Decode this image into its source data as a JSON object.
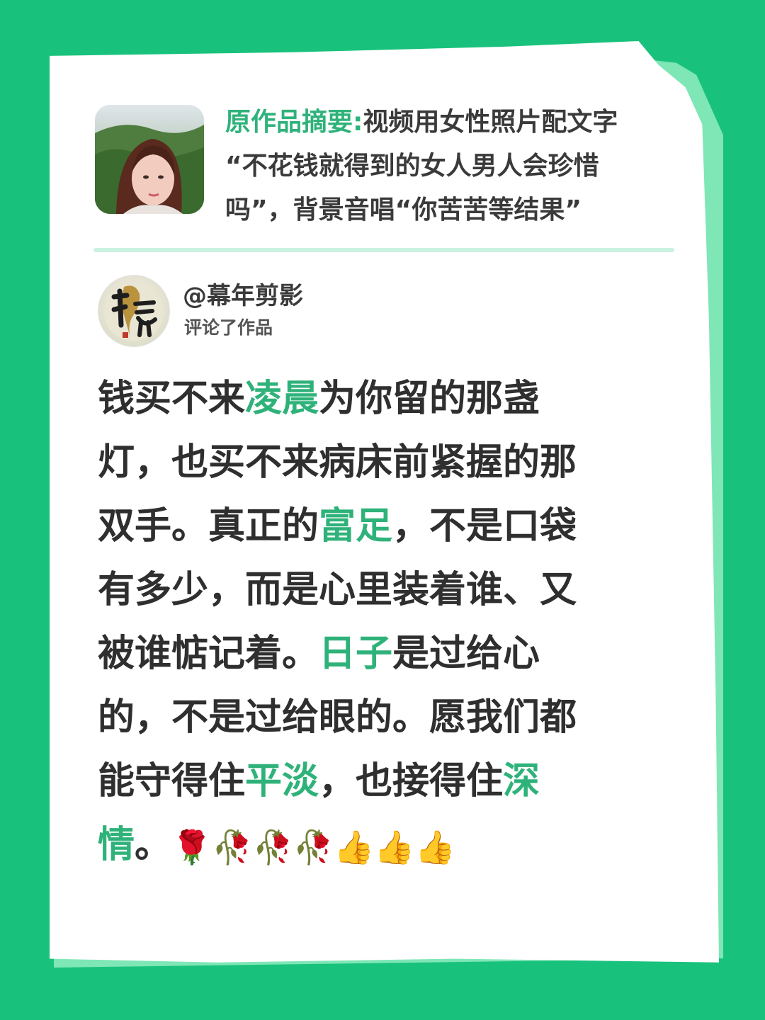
{
  "colors": {
    "background": "#19c27c",
    "accent": "#2fb27a",
    "text": "#2f2f2f",
    "paper": "#ffffff"
  },
  "summary": {
    "label": "原作品摘要:",
    "line1": "视频用女性照片配文字",
    "line2": "“不花钱就得到的女人男人会珍惜",
    "line3": "吗”，背景音唱“你苦苦等结果”"
  },
  "commenter": {
    "name": "@幕年剪影",
    "action": "评论了作品"
  },
  "comment": {
    "l1": [
      "钱买不来",
      "凌晨",
      "为你留的那盏"
    ],
    "l2": [
      "灯，也买不来病床前紧握的那"
    ],
    "l3": [
      "双手。真正的",
      "富足",
      "，不是口袋"
    ],
    "l4": [
      "有多少，而是心里装着谁、又"
    ],
    "l5": [
      "被谁惦记着。",
      "日子",
      "是过给心"
    ],
    "l6": [
      "的，不是过给眼的。愿我们都"
    ],
    "l7": [
      "能守得住",
      "平淡",
      "，也接得住",
      "深"
    ],
    "l8": [
      "情",
      "。",
      "🌹🥀🥀🥀👍👍👍"
    ]
  }
}
